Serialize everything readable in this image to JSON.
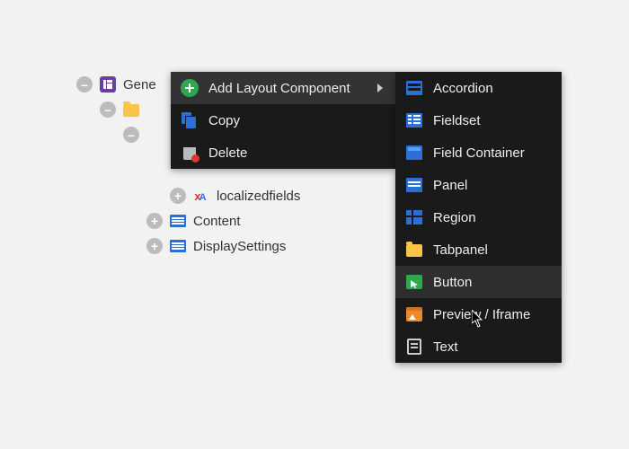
{
  "tree": {
    "root": {
      "label": "Gene"
    },
    "items": {
      "localized": "localizedfields",
      "content": "Content",
      "display": "DisplaySettings"
    }
  },
  "context_menu": {
    "add": "Add Layout Component",
    "copy": "Copy",
    "delete": "Delete"
  },
  "submenu": {
    "accordion": "Accordion",
    "fieldset": "Fieldset",
    "field_container": "Field Container",
    "panel": "Panel",
    "region": "Region",
    "tabpanel": "Tabpanel",
    "button": "Button",
    "preview": "Preview / Iframe",
    "text": "Text"
  }
}
